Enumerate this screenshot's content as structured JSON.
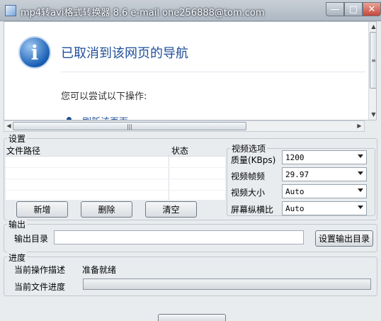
{
  "window": {
    "title": "mp4转avi格式转换器 8.6   e-mail one256888@tom.com",
    "controls": {
      "minimize": "—",
      "maximize": "□",
      "close": "✕"
    }
  },
  "browser": {
    "heading": "已取消到该网页的导航",
    "hint": "您可以尝试以下操作:",
    "link": "刷新该页面",
    "icon": "info-icon"
  },
  "settings": {
    "group_label": "设置",
    "columns": {
      "path": "文件路径",
      "status": "状态"
    },
    "buttons": {
      "add": "新增",
      "delete": "删除",
      "clear": "清空"
    },
    "video_options": {
      "label": "视频选项",
      "quality_label": "质量(KBps)",
      "quality_value": "1200",
      "fps_label": "视频帧频",
      "fps_value": "29.97",
      "size_label": "视频大小",
      "size_value": "Auto",
      "aspect_label": "屏幕纵横比",
      "aspect_value": "Auto"
    }
  },
  "output": {
    "group_label": "输出",
    "dir_label": "输出目录",
    "dir_value": "",
    "set_dir_button": "设置输出目录"
  },
  "progress": {
    "group_label": "进度",
    "op_label": "当前操作描述",
    "op_value": "准备就绪",
    "file_label": "当前文件进度",
    "file_progress": 0
  }
}
